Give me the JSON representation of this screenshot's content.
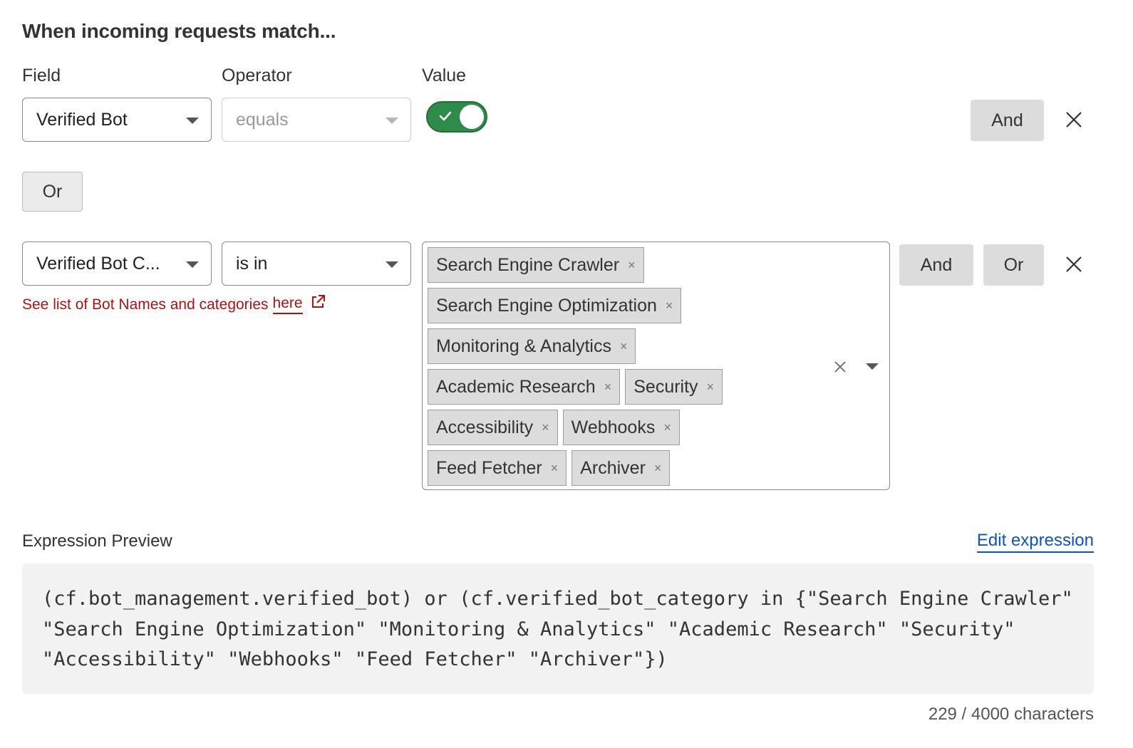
{
  "heading": "When incoming requests match...",
  "columns": {
    "field": "Field",
    "operator": "Operator",
    "value": "Value"
  },
  "row1": {
    "field": "Verified Bot",
    "operator": "equals",
    "value_toggle": "on",
    "and_label": "And"
  },
  "or_label": "Or",
  "row2": {
    "field": "Verified Bot C...",
    "operator": "is in",
    "hint_text": "See list of Bot Names and categories",
    "hint_link": "here",
    "tags": [
      "Search Engine Crawler",
      "Search Engine Optimization",
      "Monitoring & Analytics",
      "Academic Research",
      "Security",
      "Accessibility",
      "Webhooks",
      "Feed Fetcher",
      "Archiver"
    ],
    "and_label": "And",
    "or_label": "Or"
  },
  "preview": {
    "label": "Expression Preview",
    "edit_link": "Edit expression",
    "expression": "(cf.bot_management.verified_bot) or (cf.verified_bot_category in {\"Search Engine Crawler\" \"Search Engine Optimization\" \"Monitoring & Analytics\" \"Academic Research\" \"Security\" \"Accessibility\" \"Webhooks\" \"Feed Fetcher\" \"Archiver\"})",
    "char_count": "229 / 4000 characters"
  },
  "colors": {
    "toggle_on": "#2e8b4a",
    "hint_red": "#b01212",
    "link_blue": "#0b54c2"
  },
  "icons": [
    "caret-down-icon",
    "check-icon",
    "close-icon",
    "external-link-icon",
    "tag-remove-icon",
    "clear-icon"
  ]
}
